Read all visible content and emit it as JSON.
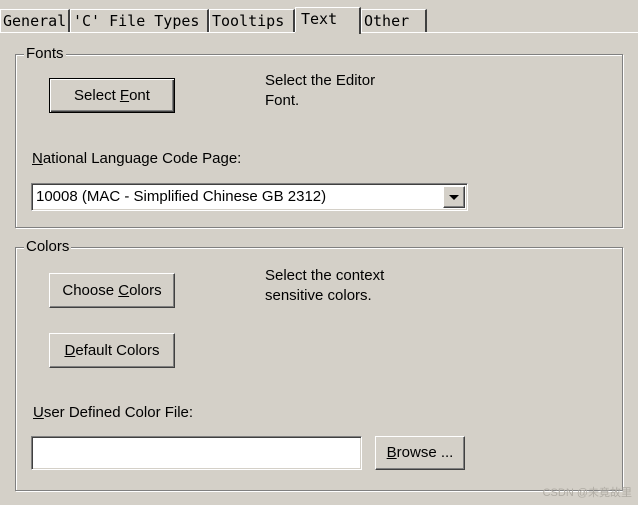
{
  "tabs": [
    {
      "label": "General"
    },
    {
      "label": "'C' File Types"
    },
    {
      "label": "Tooltips"
    },
    {
      "label": "Text",
      "active": true
    },
    {
      "label": "Other"
    }
  ],
  "fonts": {
    "group_title": "Fonts",
    "select_font_pre": "Select ",
    "select_font_mnemonic": "F",
    "select_font_post": "ont",
    "description_line1": "Select the Editor",
    "description_line2": "Font.",
    "code_page_label_mnemonic": "N",
    "code_page_label_rest": "ational Language Code Page:",
    "code_page_value": "10008 (MAC - Simplified Chinese GB 2312)"
  },
  "colors": {
    "group_title": "Colors",
    "choose_pre": "Choose ",
    "choose_mnemonic": "C",
    "choose_post": "olors",
    "description_line1": "Select the context",
    "description_line2": "sensitive colors.",
    "default_mnemonic": "D",
    "default_post": "efault Colors",
    "user_file_mnemonic": "U",
    "user_file_rest": "ser Defined Color File:",
    "user_file_value": "",
    "browse_mnemonic": "B",
    "browse_post": "rowse ..."
  },
  "watermark": "CSDN @未竟故里"
}
